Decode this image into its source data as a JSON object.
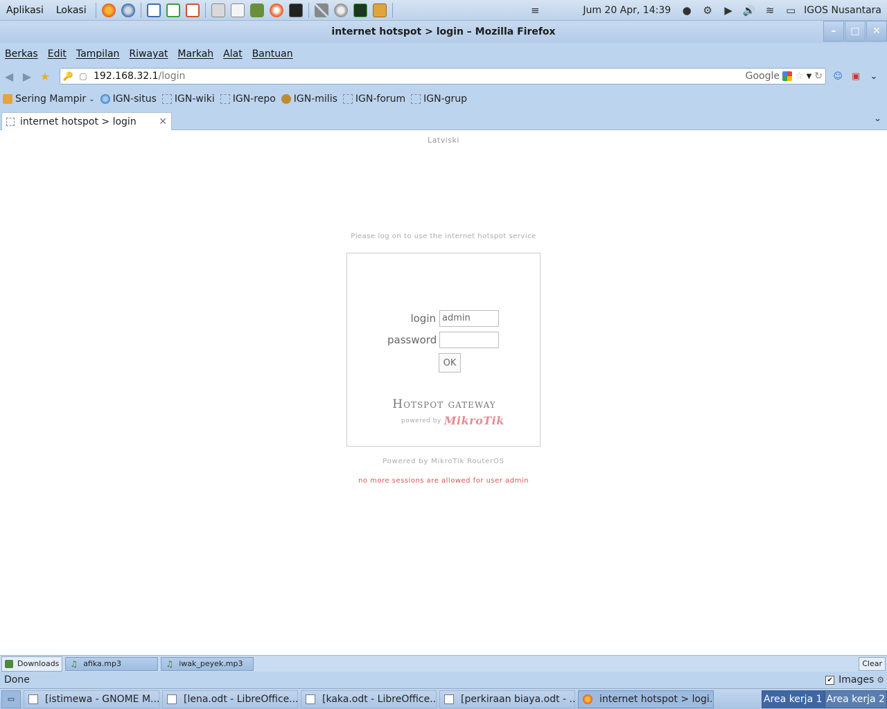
{
  "panel": {
    "menus": [
      "Aplikasi",
      "Lokasi"
    ],
    "clock": "Jum 20 Apr, 14:39",
    "user": "IGOS Nusantara"
  },
  "window": {
    "title": "internet hotspot > login – Mozilla Firefox"
  },
  "menubar": {
    "items": [
      "Berkas",
      "Edit",
      "Tampilan",
      "Riwayat",
      "Markah",
      "Alat",
      "Bantuan"
    ]
  },
  "navbar": {
    "url_host": "192.168.32.1",
    "url_path": "/login",
    "search_engine": "Google"
  },
  "bookmarks": {
    "items": [
      "Sering Mampir",
      "IGN-situs",
      "IGN-wiki",
      "IGN-repo",
      "IGN-milis",
      "IGN-forum",
      "IGN-grup"
    ]
  },
  "tabs": {
    "active": "internet hotspot > login"
  },
  "page": {
    "language": "Latviski",
    "notice": "Please log on to use the internet hotspot service",
    "login_label": "login",
    "login_value": "admin",
    "password_label": "password",
    "password_value": "",
    "ok_label": "OK",
    "brand": "Hotspot gateway",
    "powered_by": "powered by",
    "mikrotik": "MikroTik",
    "footer": "Powered by MikroTik RouterOS",
    "error": "no more sessions are allowed for user admin"
  },
  "downloads": {
    "label": "Downloads",
    "items": [
      "afika.mp3",
      "iwak_peyek.mp3"
    ],
    "clear": "Clear"
  },
  "status": {
    "text": "Done",
    "images_label": "Images",
    "images_checked": true
  },
  "taskbar": {
    "tasks": [
      "[istimewa - GNOME M...",
      "[lena.odt - LibreOffice...",
      "[kaka.odt - LibreOffice...",
      "[perkiraan biaya.odt - ...",
      "internet hotspot > logi..."
    ],
    "workspaces": [
      "Area kerja 1",
      "Area kerja 2"
    ]
  },
  "colors": {
    "panel": "#bcd4ee",
    "error": "#d9534f",
    "mikrotik": "#e28e94"
  }
}
